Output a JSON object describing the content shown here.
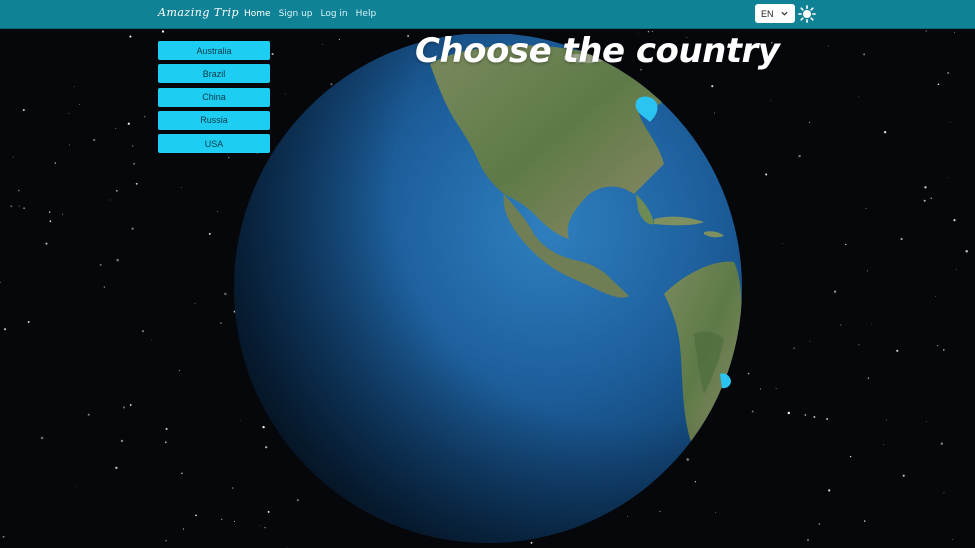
{
  "app": {
    "brand": "Amazing Trip"
  },
  "nav": {
    "links": [
      {
        "label": "Home",
        "active": true
      },
      {
        "label": "Sign up",
        "active": false
      },
      {
        "label": "Log in",
        "active": false
      },
      {
        "label": "Help",
        "active": false
      }
    ]
  },
  "language": {
    "selected": "EN"
  },
  "theme": {
    "icon": "sun-icon"
  },
  "page": {
    "title": "Choose the country"
  },
  "countries": [
    "Australia",
    "Brazil",
    "China",
    "Russia",
    "USA"
  ],
  "globe": {
    "markers": [
      "usa-marker",
      "brazil-marker"
    ]
  },
  "colors": {
    "navbar": "#0f8296",
    "country_button": "#1dcdf2",
    "marker": "#2bc3ef",
    "space": "#06070b"
  }
}
